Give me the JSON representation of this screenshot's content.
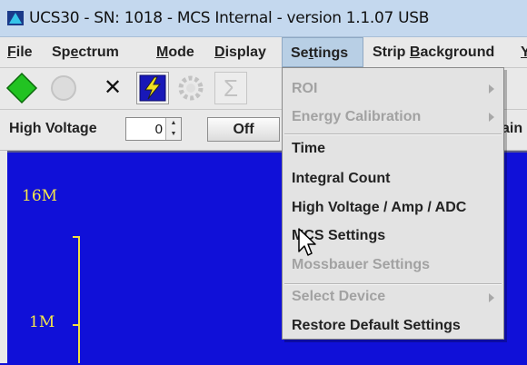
{
  "window": {
    "title": "UCS30 - SN: 1018 - MCS Internal  - version 1.1.07 USB",
    "icon": "app-logo-icon"
  },
  "menubar": {
    "items": [
      {
        "pre": "",
        "mn": "F",
        "post": "ile"
      },
      {
        "pre": "Sp",
        "mn": "e",
        "post": "ctrum"
      },
      {
        "pre": "",
        "mn": "M",
        "post": "ode"
      },
      {
        "pre": "",
        "mn": "D",
        "post": "isplay"
      },
      {
        "pre": "Se",
        "mn": "t",
        "post": "tings"
      },
      {
        "pre": "Strip ",
        "mn": "B",
        "post": "ackground"
      }
    ],
    "active_index": 4,
    "overflow_glyph": "Y"
  },
  "toolbar": {
    "buttons": [
      "start-diamond-icon",
      "stop-circle-icon",
      "clear-x-icon",
      "high-voltage-icon",
      "gear-disabled-icon",
      "sigma-disabled-icon"
    ],
    "clear_glyph": "✕",
    "sigma_glyph": "Σ"
  },
  "hv_row": {
    "label": "High Voltage",
    "value": "0",
    "off_label": "Off",
    "right_text": "ain"
  },
  "plot": {
    "y_labels": [
      "16M",
      "1M"
    ],
    "colors": {
      "background": "#1010d8",
      "axis": "#f0e040"
    }
  },
  "settings_menu": {
    "items": [
      {
        "label": "ROI",
        "enabled": false,
        "submenu": true
      },
      {
        "label": "Energy Calibration",
        "enabled": false,
        "submenu": true
      },
      {
        "label": "Time",
        "enabled": true,
        "submenu": false
      },
      {
        "label": "Integral Count",
        "enabled": true,
        "submenu": false
      },
      {
        "label": "High Voltage / Amp / ADC",
        "enabled": true,
        "submenu": false
      },
      {
        "label": "MCS Settings",
        "enabled": true,
        "submenu": false
      },
      {
        "label": "Mossbauer Settings",
        "enabled": false,
        "submenu": false
      },
      {
        "label": "Select Device",
        "enabled": false,
        "submenu": true
      },
      {
        "label": "Restore Default Settings",
        "enabled": true,
        "submenu": false
      }
    ]
  }
}
